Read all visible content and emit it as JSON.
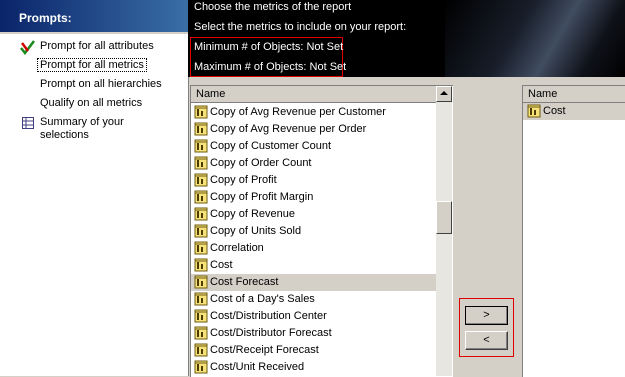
{
  "sidebar": {
    "title": "Prompts:",
    "items": [
      {
        "label": "Prompt for all attributes",
        "icon": "check-icon"
      },
      {
        "label": "Prompt for all metrics",
        "selected": true
      },
      {
        "label": "Prompt on all hierarchies"
      },
      {
        "label": "Qualify on all metrics"
      },
      {
        "label": "Summary of your selections",
        "line1": "Summary of your",
        "line2": "selections",
        "icon": "grid-icon"
      }
    ]
  },
  "info": {
    "line1": "Choose the metrics of the report",
    "line2": "Select the metrics to include on your report:",
    "min_label": "Minimum # of Objects: Not Set",
    "max_label": "Maximum # of Objects: Not Set"
  },
  "available": {
    "header": "Name",
    "items": [
      "Copy of Avg Revenue per Customer",
      "Copy of Avg Revenue per Order",
      "Copy of Customer Count",
      "Copy of Order Count",
      "Copy of Profit",
      "Copy of Profit Margin",
      "Copy of Revenue",
      "Copy of Units Sold",
      "Correlation",
      "Cost",
      "Cost Forecast",
      "Cost of a Day's Sales",
      "Cost/Distribution Center",
      "Cost/Distributor Forecast",
      "Cost/Receipt Forecast",
      "Cost/Unit Received"
    ],
    "highlighted": "Cost Forecast"
  },
  "buttons": {
    "add_label": ">",
    "remove_label": "<"
  },
  "selected": {
    "header": "Name",
    "items": [
      "Cost"
    ]
  },
  "colors": {
    "highlight_box": "#e00000",
    "sidebar_header": "#0a246a"
  }
}
